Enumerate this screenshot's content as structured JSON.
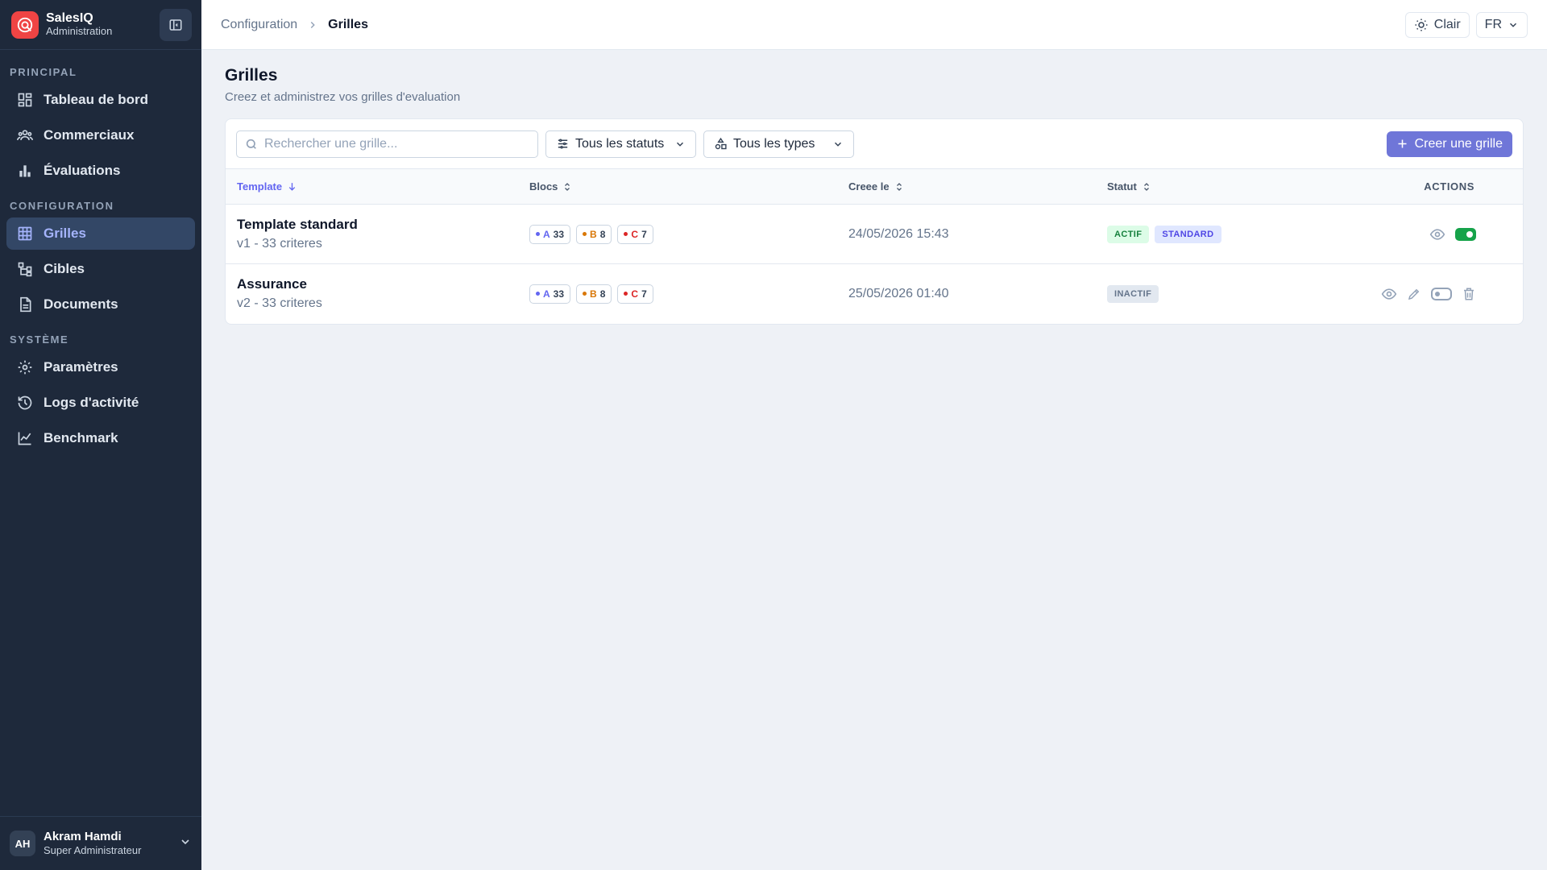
{
  "brand": {
    "name": "SalesIQ",
    "subtitle": "Administration"
  },
  "sidebar": {
    "sections": [
      {
        "title": "PRINCIPAL",
        "items": [
          {
            "label": "Tableau de bord",
            "icon": "dashboard-icon"
          },
          {
            "label": "Commerciaux",
            "icon": "users-icon"
          },
          {
            "label": "Évaluations",
            "icon": "bar-chart-icon"
          }
        ]
      },
      {
        "title": "CONFIGURATION",
        "items": [
          {
            "label": "Grilles",
            "icon": "grid-icon",
            "active": true
          },
          {
            "label": "Cibles",
            "icon": "hierarchy-icon"
          },
          {
            "label": "Documents",
            "icon": "document-icon"
          }
        ]
      },
      {
        "title": "SYSTÈME",
        "items": [
          {
            "label": "Paramètres",
            "icon": "gear-icon"
          },
          {
            "label": "Logs d'activité",
            "icon": "history-icon"
          },
          {
            "label": "Benchmark",
            "icon": "chart-line-icon"
          }
        ]
      }
    ]
  },
  "user": {
    "initials": "AH",
    "name": "Akram Hamdi",
    "role": "Super Administrateur"
  },
  "header": {
    "breadcrumb": [
      "Configuration",
      "Grilles"
    ],
    "theme_label": "Clair",
    "lang_label": "FR"
  },
  "page": {
    "title": "Grilles",
    "subtitle": "Creez et administrez vos grilles d'evaluation"
  },
  "toolbar": {
    "search_placeholder": "Rechercher une grille...",
    "status_filter": "Tous les statuts",
    "type_filter": "Tous les types",
    "create_label": "Creer une grille"
  },
  "table": {
    "columns": [
      "Template",
      "Blocs",
      "Creee le",
      "Statut",
      "ACTIONS"
    ],
    "rows": [
      {
        "title": "Template standard",
        "subtitle": "v1 - 33 criteres",
        "blocs": [
          {
            "letter": "A",
            "count": "33"
          },
          {
            "letter": "B",
            "count": "8"
          },
          {
            "letter": "C",
            "count": "7"
          }
        ],
        "created": "24/05/2026 15:43",
        "badges": [
          "ACTIF",
          "STANDARD"
        ],
        "active": true
      },
      {
        "title": "Assurance",
        "subtitle": "v2 - 33 criteres",
        "blocs": [
          {
            "letter": "A",
            "count": "33"
          },
          {
            "letter": "B",
            "count": "8"
          },
          {
            "letter": "C",
            "count": "7"
          }
        ],
        "created": "25/05/2026 01:40",
        "badges": [
          "INACTIF"
        ],
        "active": false
      }
    ]
  },
  "colors": {
    "accent": "#6366f1",
    "bloc_a": "#6366f1",
    "bloc_b": "#d97706",
    "bloc_c": "#dc2626",
    "active_green": "#16a34a",
    "sidebar_bg": "#1e293b"
  }
}
